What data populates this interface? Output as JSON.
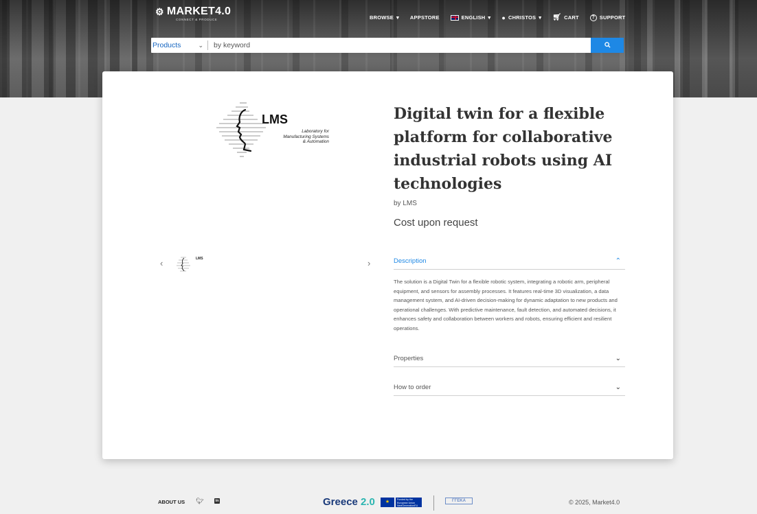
{
  "header": {
    "logo_text": "MARKET4.0",
    "logo_tagline": "CONNECT & PRODUCE",
    "nav": {
      "browse": "BROWSE",
      "appstore": "APPSTORE",
      "language": "ENGLISH",
      "user": "CHRISTOS",
      "cart": "CART",
      "support": "SUPPORT"
    }
  },
  "search": {
    "category": "Products",
    "placeholder": "by keyword"
  },
  "product": {
    "image_title": "LMS",
    "image_subtitle_line1": "Laboratory for",
    "image_subtitle_line2": "Manufacturing Systems",
    "image_subtitle_line3": "& Automation",
    "thumb_label": "LMS",
    "title": "Digital twin for a flexible platform for collaborative industrial robots using AI technologies",
    "vendor": "by LMS",
    "price": "Cost upon request"
  },
  "accordion": {
    "description_label": "Description",
    "description_text": "The solution is a Digital Twin for a flexible robotic system, integrating a robotic arm, peripheral equipment, and sensors for assembly processes. It features real-time 3D visualization, a data management system, and AI-driven decision-making for dynamic adaptation to new products and operational challenges. With predictive maintenance, fault detection, and automated decisions, it enhances safety and collaboration between workers and robots, ensuring efficient and resilient operations.",
    "properties_label": "Properties",
    "how_to_order_label": "How to order"
  },
  "footer": {
    "about": "ABOUT US",
    "greece_part1": "Greece ",
    "greece_part2": "2.0",
    "eu_text": "Funded by the European Union NextGenerationEU",
    "gsri": "ΓΓΕΚΑ",
    "copyright": "© 2025, Market4.0"
  },
  "colors": {
    "accent": "#1e88e5",
    "title": "#333333",
    "hero": "#4d4d4d"
  }
}
